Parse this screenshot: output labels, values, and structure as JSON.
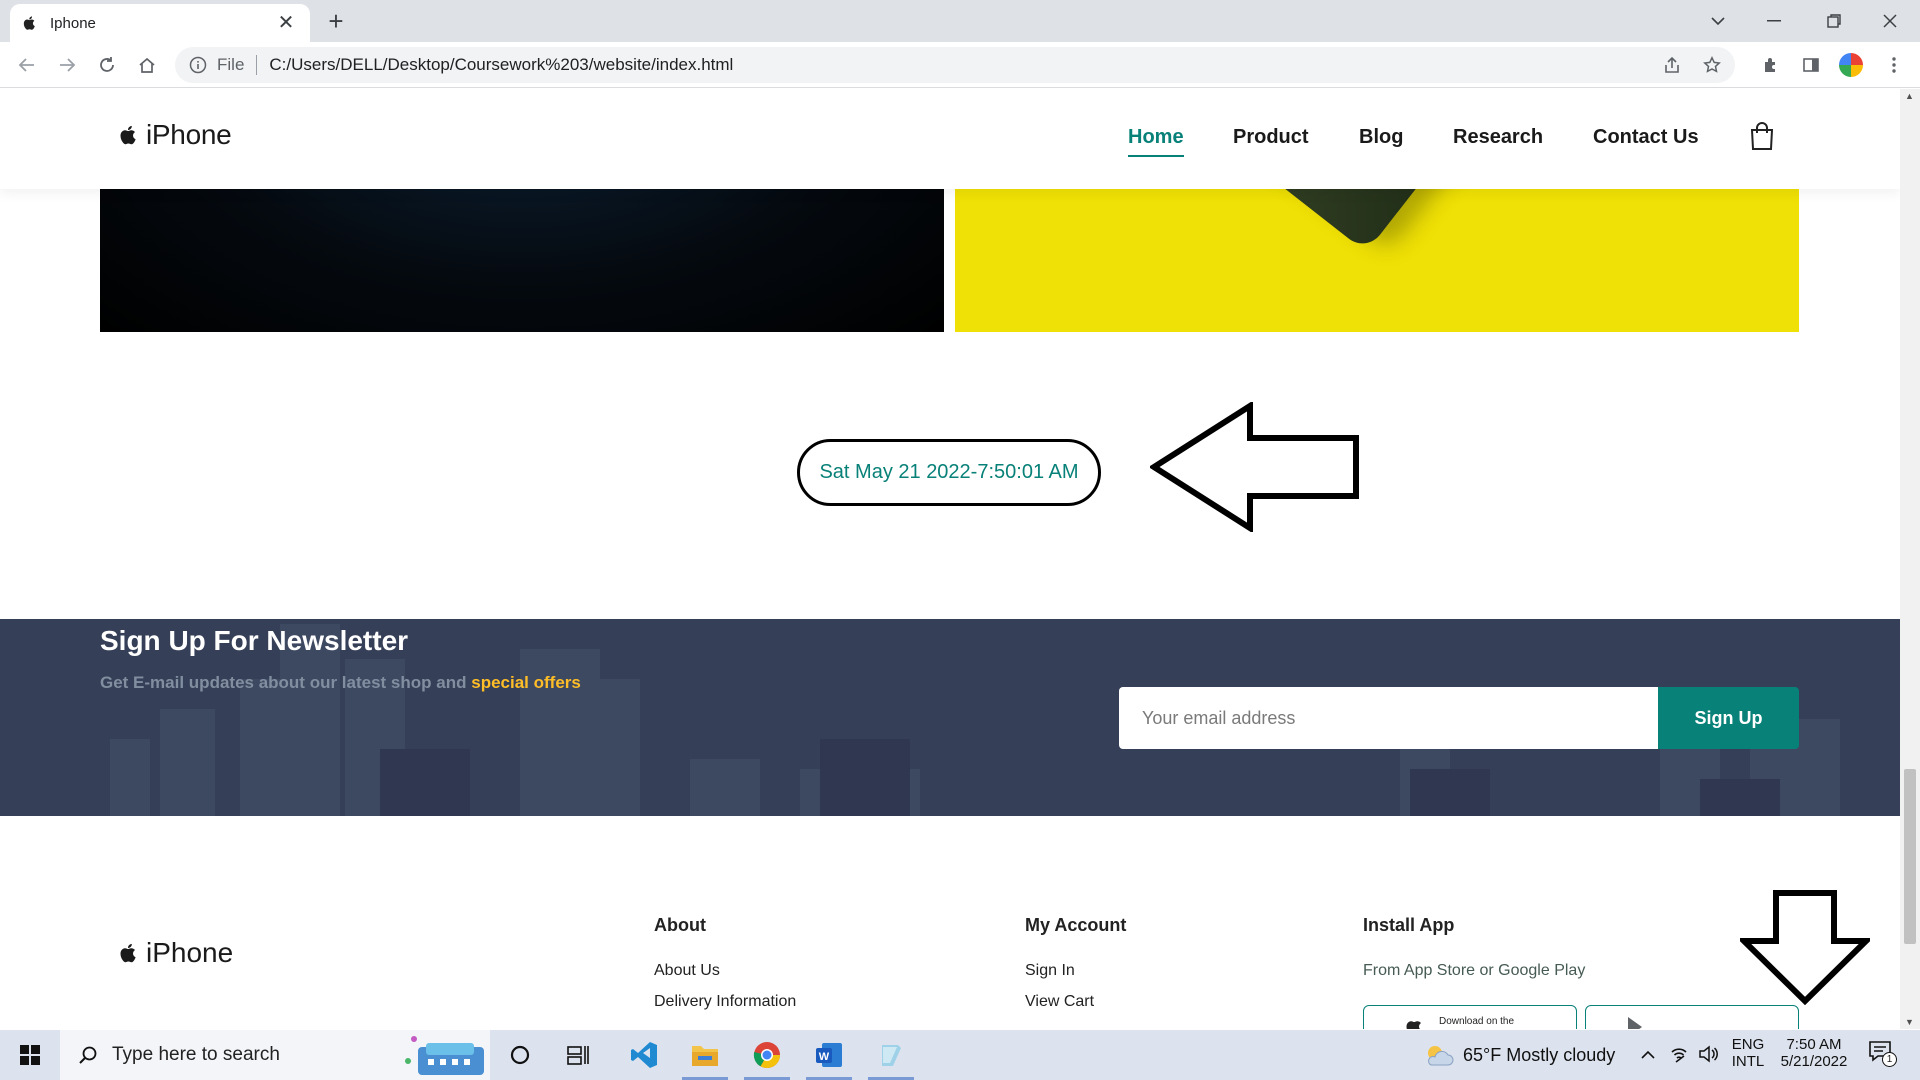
{
  "browser": {
    "tab_title": "Iphone",
    "omnibox": {
      "scheme": "File",
      "url": "C:/Users/DELL/Desktop/Coursework%203/website/index.html"
    }
  },
  "site": {
    "brand": "iPhone",
    "nav": [
      {
        "label": "Home",
        "active": true
      },
      {
        "label": "Product",
        "active": false
      },
      {
        "label": "Blog",
        "active": false
      },
      {
        "label": "Research",
        "active": false
      },
      {
        "label": "Contact Us",
        "active": false
      }
    ],
    "datetime": "Sat May 21 2022-7:50:01 AM",
    "newsletter": {
      "title": "Sign Up For Newsletter",
      "subtitle_prefix": "Get E-mail updates about our latest shop and",
      "subtitle_highlight": "special offers",
      "email_placeholder": "Your email address",
      "button_label": "Sign Up"
    },
    "footer": {
      "brand": "iPhone",
      "about": {
        "title": "About",
        "links": [
          "About Us",
          "Delivery Information"
        ]
      },
      "account": {
        "title": "My Account",
        "links": [
          "Sign In",
          "View Cart"
        ]
      },
      "install": {
        "title": "Install App",
        "subtitle": "From App Store or Google Play",
        "appstore_label": "Download on the"
      }
    },
    "colors": {
      "accent": "#088178",
      "highlight": "#ffbd27",
      "newsletter_bg": "#353f57",
      "hero_right_bg": "#efe005"
    }
  },
  "taskbar": {
    "search_placeholder": "Type here to search",
    "weather": "65°F  Mostly cloudy",
    "lang_top": "ENG",
    "lang_bottom": "INTL",
    "time": "7:50 AM",
    "date": "5/21/2022",
    "notification_count": "1",
    "apps": [
      "task-view",
      "vscode",
      "file-explorer",
      "chrome",
      "word",
      "notepad"
    ]
  }
}
